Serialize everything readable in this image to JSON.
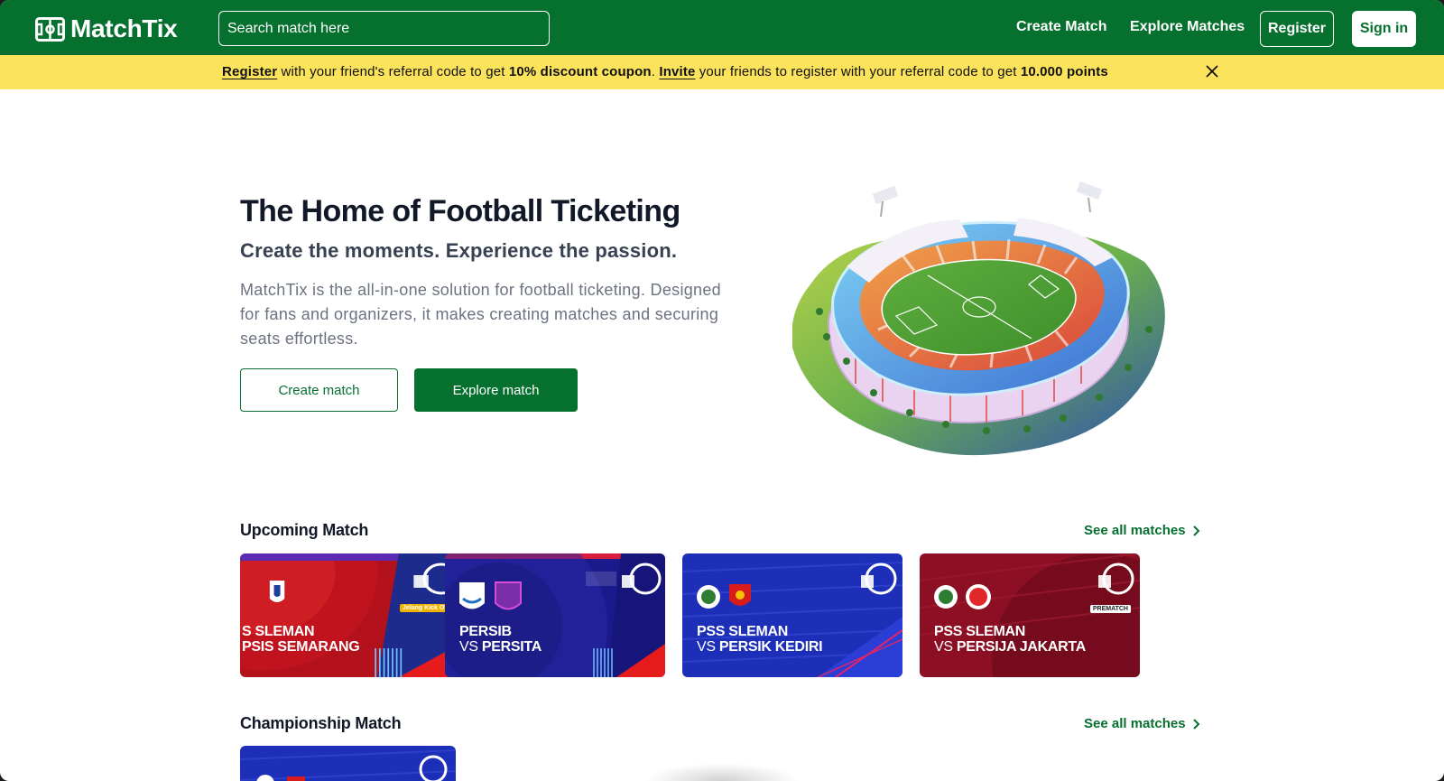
{
  "nav": {
    "brand": "MatchTix",
    "search_placeholder": "Search match here",
    "links": [
      "Create Match",
      "Explore Matches"
    ],
    "register_label": "Register",
    "signin_label": "Sign in"
  },
  "banner": {
    "register_link": "Register",
    "text1": " with your friend's referral code to get ",
    "highlight1": "10% discount coupon",
    "text2": ". ",
    "invite_link": "Invite",
    "text3": " your friends to register with your referral code to get ",
    "highlight2": "10.000 points"
  },
  "hero": {
    "title": "The Home of Football Ticketing",
    "subtitle": "Create the moments. Experience the passion.",
    "description": "MatchTix is the all-in-one solution for football ticketing. Designed for fans and organizers, it makes creating matches and securing seats effortless.",
    "create_label": "Create match",
    "explore_label": "Explore match"
  },
  "upcoming": {
    "title": "Upcoming Match",
    "see_all": "See all matches",
    "cards": [
      {
        "home": "S SLEMAN",
        "vs": "",
        "away": "PSIS SEMARANG",
        "tag": "Jelang Kick Off",
        "theme": "red"
      },
      {
        "home": "PERSIB",
        "vs": "VS ",
        "away": "PERSITA",
        "tag": "",
        "theme": "navy"
      },
      {
        "home": "PSS SLEMAN",
        "vs": "VS ",
        "away": "PERSIK KEDIRI",
        "tag": "",
        "theme": "blue"
      },
      {
        "home": "PSS SLEMAN",
        "vs": "VS ",
        "away": "PERSIJA JAKARTA",
        "tag": "PREMATCH",
        "theme": "maroon"
      }
    ]
  },
  "championship": {
    "title": "Championship Match",
    "see_all": "See all matches"
  },
  "colors": {
    "brand_green": "#06702f",
    "banner_yellow": "#fbe35b"
  }
}
